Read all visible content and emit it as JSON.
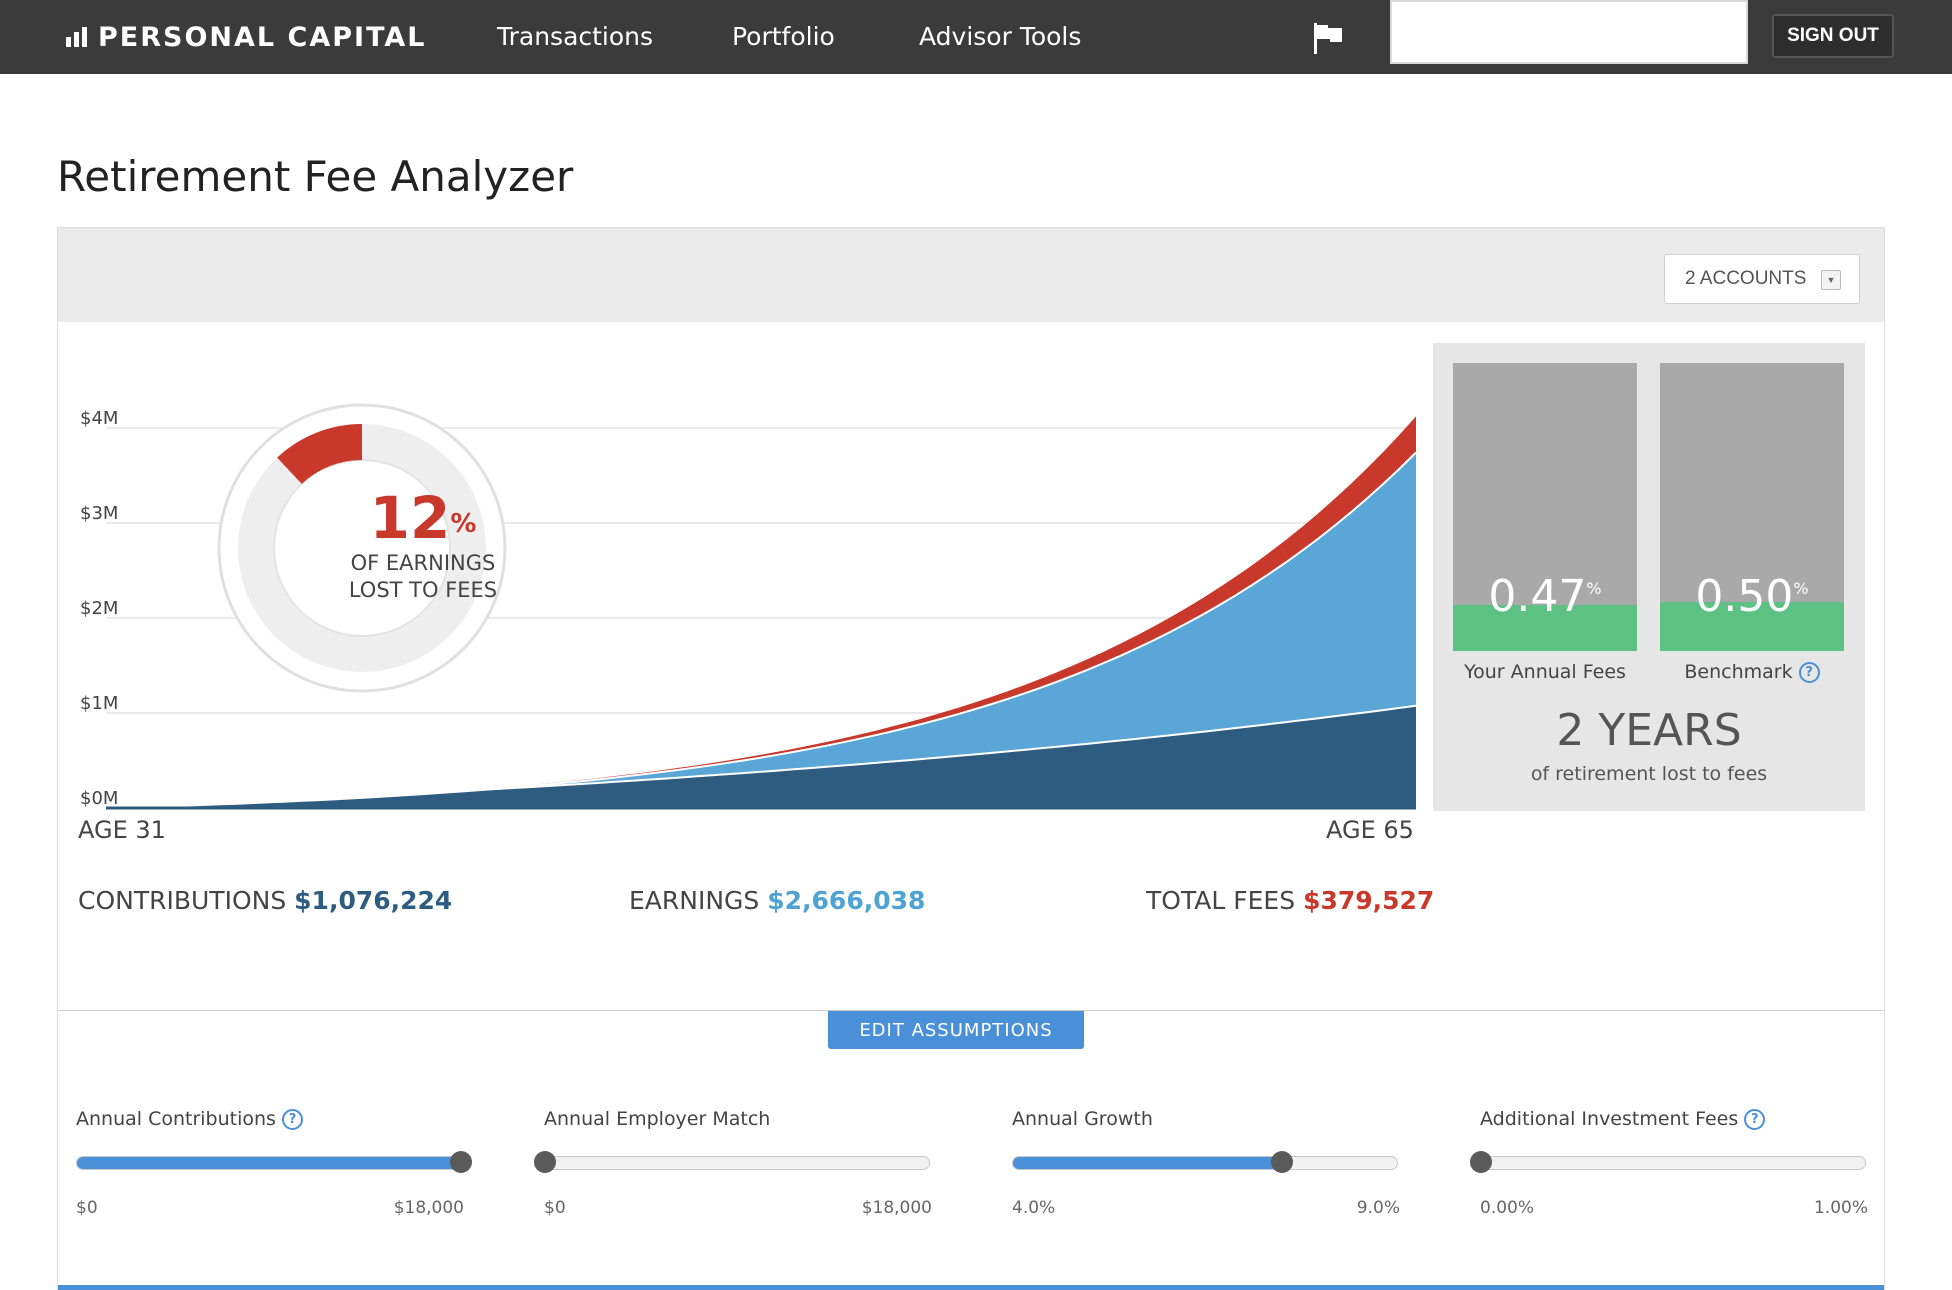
{
  "nav": {
    "brand": "PERSONAL CAPITAL",
    "links": [
      "Transactions",
      "Portfolio",
      "Advisor Tools"
    ],
    "search_value": "",
    "sign_out": "SIGN OUT"
  },
  "page": {
    "title": "Retirement Fee Analyzer"
  },
  "accounts_select": {
    "selected": "2 ACCOUNTS"
  },
  "donut": {
    "percent_value": "12",
    "percent_sign": "%",
    "line1": "OF EARNINGS",
    "line2": "LOST TO FEES",
    "fraction_lost": 0.12
  },
  "chart_data": {
    "type": "area",
    "y_ticks": [
      "$4M",
      "$3M",
      "$2M",
      "$1M",
      "$0M"
    ],
    "ylim": [
      0,
      4000000
    ],
    "x_start_label": "AGE 31",
    "x_end_label": "AGE 65",
    "x": [
      31,
      65
    ],
    "series": [
      {
        "key": "contributions",
        "color": "#2e5c80",
        "end_value": 1076224
      },
      {
        "key": "earnings",
        "color": "#5aa6d6",
        "end_value": 3742262
      },
      {
        "key": "fees",
        "color": "#c8382b",
        "end_value": 4121789
      }
    ]
  },
  "summary": {
    "contributions_label": "CONTRIBUTIONS",
    "contributions_value": "$1,076,224",
    "earnings_label": "EARNINGS",
    "earnings_value": "$2,666,038",
    "fees_label": "TOTAL FEES",
    "fees_value": "$379,527"
  },
  "fees": {
    "yours": {
      "value": "0.47",
      "unit": "%",
      "caption": "Your Annual Fees",
      "fill_fraction": 0.16
    },
    "benchmark": {
      "value": "0.50",
      "unit": "%",
      "caption": "Benchmark",
      "fill_fraction": 0.17
    },
    "years_big": "2 YEARS",
    "years_sub": "of retirement lost to fees"
  },
  "edit_button": "EDIT ASSUMPTIONS",
  "sliders": [
    {
      "label": "Annual Contributions",
      "help": true,
      "min": "$0",
      "max": "$18,000",
      "position": 1.0,
      "filled": true
    },
    {
      "label": "Annual Employer Match",
      "help": false,
      "min": "$0",
      "max": "$18,000",
      "position": 0.0,
      "filled": true
    },
    {
      "label": "Annual Growth",
      "help": false,
      "min": "4.0%",
      "max": "9.0%",
      "position": 0.7,
      "filled": true
    },
    {
      "label": "Additional Investment Fees",
      "help": true,
      "min": "0.00%",
      "max": "1.00%",
      "position": 0.0,
      "filled": true
    }
  ],
  "colors": {
    "nav_bg": "#3b3b3b",
    "accent": "#4a90d9",
    "fee_red": "#c8382b",
    "earnings_blue": "#5aa6d6",
    "contrib_blue": "#2e5c80",
    "fee_green": "#5cc183",
    "bar_gray": "#a9a9a9"
  }
}
